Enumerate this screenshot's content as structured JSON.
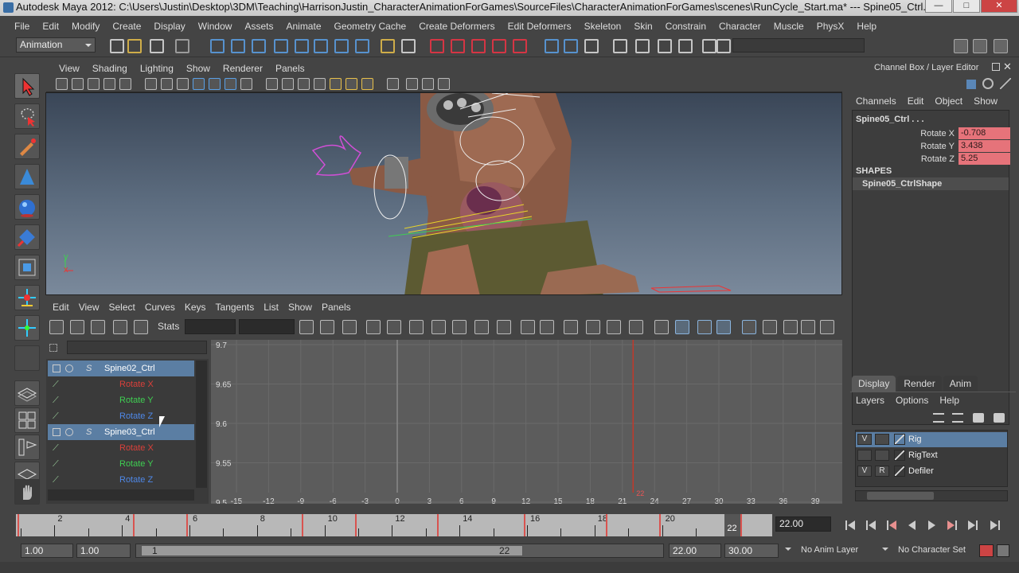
{
  "window": {
    "title": "Autodesk Maya 2012: C:\\Users\\Justin\\Desktop\\3DM\\Teaching\\HarrisonJustin_CharacterAnimationForGames\\SourceFiles\\CharacterAnimationForGames\\scenes\\RunCycle_Start.ma*   ---   Spine05_Ctrl...",
    "minimize": "—",
    "maximize": "□",
    "close": "✕"
  },
  "menu": [
    "File",
    "Edit",
    "Modify",
    "Create",
    "Display",
    "Window",
    "Assets",
    "Animate",
    "Geometry Cache",
    "Create Deformers",
    "Edit Deformers",
    "Skeleton",
    "Skin",
    "Constrain",
    "Character",
    "Muscle",
    "PhysX",
    "Help"
  ],
  "mode_selector": {
    "value": "Animation"
  },
  "viewport": {
    "menu": [
      "View",
      "Shading",
      "Lighting",
      "Show",
      "Renderer",
      "Panels"
    ],
    "axis": {
      "y": "y",
      "x": "x"
    }
  },
  "graph_editor": {
    "menu": [
      "Edit",
      "View",
      "Select",
      "Curves",
      "Keys",
      "Tangents",
      "List",
      "Show",
      "Panels"
    ],
    "stats_label": "Stats",
    "outliner": [
      {
        "label": "Spine02_Ctrl",
        "kind": "object",
        "selected": true
      },
      {
        "label": "Rotate X",
        "kind": "channel",
        "color": "#d9403a"
      },
      {
        "label": "Rotate Y",
        "kind": "channel",
        "color": "#3fcf52"
      },
      {
        "label": "Rotate Z",
        "kind": "channel",
        "color": "#4f88e8"
      },
      {
        "label": "Spine03_Ctrl",
        "kind": "object",
        "selected": true
      },
      {
        "label": "Rotate X",
        "kind": "channel",
        "color": "#d9403a"
      },
      {
        "label": "Rotate Y",
        "kind": "channel",
        "color": "#3fcf52"
      },
      {
        "label": "Rotate Z",
        "kind": "channel",
        "color": "#4f88e8"
      }
    ],
    "y_ticks": [
      "9.7",
      "9.65",
      "9.6",
      "9.55",
      "9.5"
    ],
    "x_ticks": [
      "-15",
      "-12",
      "-9",
      "-6",
      "-3",
      "0",
      "3",
      "6",
      "9",
      "12",
      "15",
      "18",
      "21",
      "24",
      "27",
      "30",
      "33",
      "36",
      "39"
    ],
    "current_frame_label": "22"
  },
  "channel_box": {
    "title": "Channel Box / Layer Editor",
    "menu": [
      "Channels",
      "Edit",
      "Object",
      "Show"
    ],
    "object_name": "Spine05_Ctrl . . .",
    "attributes": [
      {
        "label": "Rotate X",
        "value": "-0.708"
      },
      {
        "label": "Rotate Y",
        "value": "3.438"
      },
      {
        "label": "Rotate Z",
        "value": "5.25"
      }
    ],
    "shapes_header": "SHAPES",
    "shape_name": "Spine05_CtrlShape"
  },
  "layer_editor": {
    "tabs": [
      "Display",
      "Render",
      "Anim"
    ],
    "menu": [
      "Layers",
      "Options",
      "Help"
    ],
    "layers": [
      {
        "v": "V",
        "r": "",
        "name": "Rig",
        "selected": true
      },
      {
        "v": "",
        "r": "",
        "name": "RigText",
        "selected": false
      },
      {
        "v": "V",
        "r": "R",
        "name": "Defiler",
        "selected": false
      }
    ]
  },
  "time_slider": {
    "labels": [
      "2",
      "4",
      "6",
      "8",
      "10",
      "12",
      "14",
      "16",
      "18",
      "20",
      "22"
    ],
    "current_frame": "22",
    "current_time_field": "22.00"
  },
  "range_slider": {
    "start": "1.00",
    "anim_start": "1.00",
    "range_start": "1",
    "range_end": "22",
    "anim_end": "22.00",
    "end": "30.00",
    "anim_layer": "No Anim Layer",
    "character_set": "No Character Set"
  },
  "colors": {
    "selection": "#5b7ea3",
    "keyed": "#e6737a",
    "time_marker": "#c0392b"
  }
}
